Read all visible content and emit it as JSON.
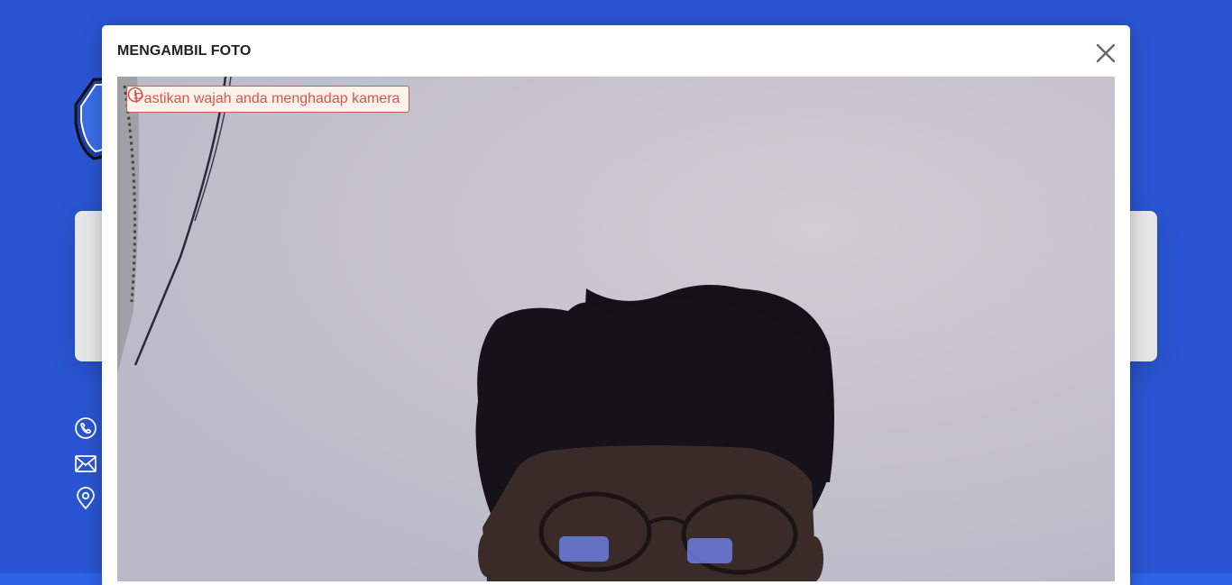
{
  "modal": {
    "title": "MENGAMBIL FOTO",
    "close_icon": "close-icon"
  },
  "alert": {
    "icon": "exclamation-circle-icon",
    "text": "Pastikan wajah anda menghadap kamera",
    "color": "#d9534f"
  },
  "background": {
    "accent_color": "#2a55d2",
    "contact_icons": [
      "phone-icon",
      "mail-icon",
      "location-pin-icon"
    ]
  }
}
